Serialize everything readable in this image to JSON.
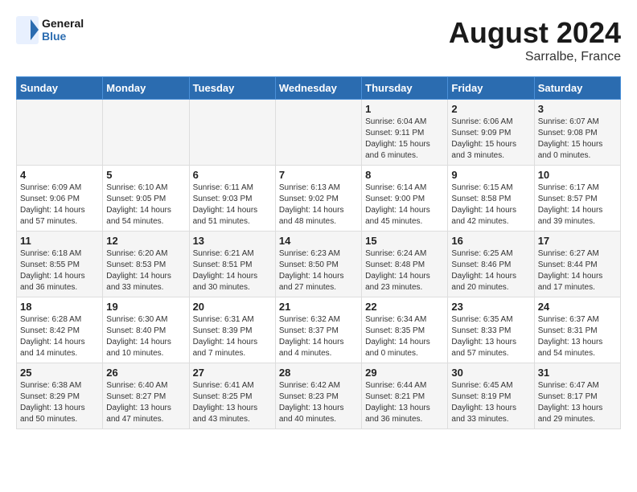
{
  "header": {
    "logo_line1": "General",
    "logo_line2": "Blue",
    "month_year": "August 2024",
    "location": "Sarralbe, France"
  },
  "days_of_week": [
    "Sunday",
    "Monday",
    "Tuesday",
    "Wednesday",
    "Thursday",
    "Friday",
    "Saturday"
  ],
  "weeks": [
    [
      {
        "day": "",
        "info": ""
      },
      {
        "day": "",
        "info": ""
      },
      {
        "day": "",
        "info": ""
      },
      {
        "day": "",
        "info": ""
      },
      {
        "day": "1",
        "info": "Sunrise: 6:04 AM\nSunset: 9:11 PM\nDaylight: 15 hours\nand 6 minutes."
      },
      {
        "day": "2",
        "info": "Sunrise: 6:06 AM\nSunset: 9:09 PM\nDaylight: 15 hours\nand 3 minutes."
      },
      {
        "day": "3",
        "info": "Sunrise: 6:07 AM\nSunset: 9:08 PM\nDaylight: 15 hours\nand 0 minutes."
      }
    ],
    [
      {
        "day": "4",
        "info": "Sunrise: 6:09 AM\nSunset: 9:06 PM\nDaylight: 14 hours\nand 57 minutes."
      },
      {
        "day": "5",
        "info": "Sunrise: 6:10 AM\nSunset: 9:05 PM\nDaylight: 14 hours\nand 54 minutes."
      },
      {
        "day": "6",
        "info": "Sunrise: 6:11 AM\nSunset: 9:03 PM\nDaylight: 14 hours\nand 51 minutes."
      },
      {
        "day": "7",
        "info": "Sunrise: 6:13 AM\nSunset: 9:02 PM\nDaylight: 14 hours\nand 48 minutes."
      },
      {
        "day": "8",
        "info": "Sunrise: 6:14 AM\nSunset: 9:00 PM\nDaylight: 14 hours\nand 45 minutes."
      },
      {
        "day": "9",
        "info": "Sunrise: 6:15 AM\nSunset: 8:58 PM\nDaylight: 14 hours\nand 42 minutes."
      },
      {
        "day": "10",
        "info": "Sunrise: 6:17 AM\nSunset: 8:57 PM\nDaylight: 14 hours\nand 39 minutes."
      }
    ],
    [
      {
        "day": "11",
        "info": "Sunrise: 6:18 AM\nSunset: 8:55 PM\nDaylight: 14 hours\nand 36 minutes."
      },
      {
        "day": "12",
        "info": "Sunrise: 6:20 AM\nSunset: 8:53 PM\nDaylight: 14 hours\nand 33 minutes."
      },
      {
        "day": "13",
        "info": "Sunrise: 6:21 AM\nSunset: 8:51 PM\nDaylight: 14 hours\nand 30 minutes."
      },
      {
        "day": "14",
        "info": "Sunrise: 6:23 AM\nSunset: 8:50 PM\nDaylight: 14 hours\nand 27 minutes."
      },
      {
        "day": "15",
        "info": "Sunrise: 6:24 AM\nSunset: 8:48 PM\nDaylight: 14 hours\nand 23 minutes."
      },
      {
        "day": "16",
        "info": "Sunrise: 6:25 AM\nSunset: 8:46 PM\nDaylight: 14 hours\nand 20 minutes."
      },
      {
        "day": "17",
        "info": "Sunrise: 6:27 AM\nSunset: 8:44 PM\nDaylight: 14 hours\nand 17 minutes."
      }
    ],
    [
      {
        "day": "18",
        "info": "Sunrise: 6:28 AM\nSunset: 8:42 PM\nDaylight: 14 hours\nand 14 minutes."
      },
      {
        "day": "19",
        "info": "Sunrise: 6:30 AM\nSunset: 8:40 PM\nDaylight: 14 hours\nand 10 minutes."
      },
      {
        "day": "20",
        "info": "Sunrise: 6:31 AM\nSunset: 8:39 PM\nDaylight: 14 hours\nand 7 minutes."
      },
      {
        "day": "21",
        "info": "Sunrise: 6:32 AM\nSunset: 8:37 PM\nDaylight: 14 hours\nand 4 minutes."
      },
      {
        "day": "22",
        "info": "Sunrise: 6:34 AM\nSunset: 8:35 PM\nDaylight: 14 hours\nand 0 minutes."
      },
      {
        "day": "23",
        "info": "Sunrise: 6:35 AM\nSunset: 8:33 PM\nDaylight: 13 hours\nand 57 minutes."
      },
      {
        "day": "24",
        "info": "Sunrise: 6:37 AM\nSunset: 8:31 PM\nDaylight: 13 hours\nand 54 minutes."
      }
    ],
    [
      {
        "day": "25",
        "info": "Sunrise: 6:38 AM\nSunset: 8:29 PM\nDaylight: 13 hours\nand 50 minutes."
      },
      {
        "day": "26",
        "info": "Sunrise: 6:40 AM\nSunset: 8:27 PM\nDaylight: 13 hours\nand 47 minutes."
      },
      {
        "day": "27",
        "info": "Sunrise: 6:41 AM\nSunset: 8:25 PM\nDaylight: 13 hours\nand 43 minutes."
      },
      {
        "day": "28",
        "info": "Sunrise: 6:42 AM\nSunset: 8:23 PM\nDaylight: 13 hours\nand 40 minutes."
      },
      {
        "day": "29",
        "info": "Sunrise: 6:44 AM\nSunset: 8:21 PM\nDaylight: 13 hours\nand 36 minutes."
      },
      {
        "day": "30",
        "info": "Sunrise: 6:45 AM\nSunset: 8:19 PM\nDaylight: 13 hours\nand 33 minutes."
      },
      {
        "day": "31",
        "info": "Sunrise: 6:47 AM\nSunset: 8:17 PM\nDaylight: 13 hours\nand 29 minutes."
      }
    ]
  ]
}
